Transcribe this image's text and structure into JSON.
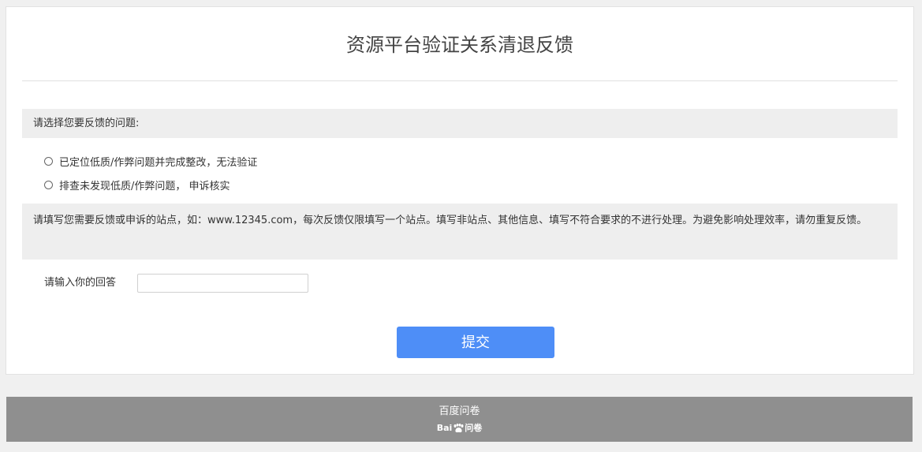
{
  "form": {
    "title": "资源平台验证关系清退反馈",
    "question1": {
      "label": "请选择您要反馈的问题:",
      "options": [
        "已定位低质/作弊问题并完成整改，无法验证",
        "排查未发现低质/作弊问题， 申诉核实"
      ]
    },
    "question2": {
      "label": "请填写您需要反馈或申诉的站点，如：www.12345.com，每次反馈仅限填写一个站点。填写非站点、其他信息、填写不符合要求的不进行处理。为避免影响处理效率，请勿重复反馈。"
    },
    "answer": {
      "label": "请输入你的回答",
      "value": "",
      "placeholder": ""
    },
    "submit_label": "提交"
  },
  "footer": {
    "text": "百度问卷",
    "logo_text_left": "Bai",
    "logo_text_right": "问卷",
    "logo_icon": "baidu-paw-icon"
  },
  "colors": {
    "accent": "#4e8ef7",
    "footer_bg": "#8f8f8f",
    "section_bg": "#eeeeee"
  }
}
